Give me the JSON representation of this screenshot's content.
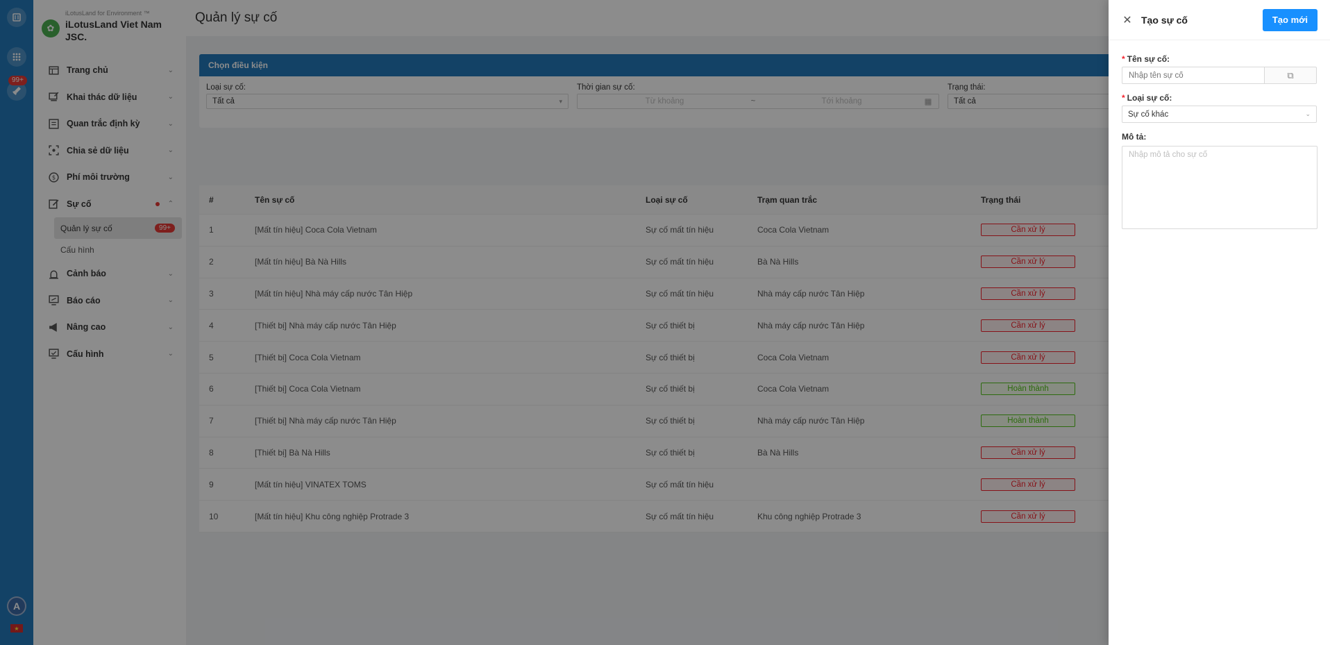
{
  "rail": {
    "badge": "99+"
  },
  "brand": {
    "sub": "iLotusLand for Environment ™",
    "name": "iLotusLand Viet Nam JSC."
  },
  "sidebar": {
    "items": [
      {
        "label": "Trang chủ",
        "icon": "home-icon"
      },
      {
        "label": "Khai thác dữ liệu",
        "icon": "data-icon"
      },
      {
        "label": "Quan trắc định kỳ",
        "icon": "monitor-icon"
      },
      {
        "label": "Chia sẻ dữ liệu",
        "icon": "share-icon"
      },
      {
        "label": "Phí môi trường",
        "icon": "fee-icon"
      },
      {
        "label": "Sự cố",
        "icon": "incident-icon"
      },
      {
        "label": "Cảnh báo",
        "icon": "alarm-icon"
      },
      {
        "label": "Báo cáo",
        "icon": "report-icon"
      },
      {
        "label": "Nâng cao",
        "icon": "megaphone-icon"
      },
      {
        "label": "Cấu hình",
        "icon": "config-icon"
      }
    ],
    "sub": {
      "manage": "Quản lý sự cố",
      "manage_badge": "99+",
      "config": "Cấu hình"
    }
  },
  "page": {
    "title": "Quản lý sự cố"
  },
  "filter": {
    "header": "Chọn điều kiện",
    "type_label": "Loại sự cố:",
    "type_value": "Tất cả",
    "time_label": "Thời gian sự cố:",
    "time_from": "Từ khoảng",
    "time_sep": "~",
    "time_to": "Tới khoảng",
    "status_label": "Trạng thái:",
    "status_value": "Tất cả"
  },
  "table": {
    "headers": {
      "num": "#",
      "name": "Tên sự cố",
      "type": "Loại sự cố",
      "station": "Trạm quan trắc",
      "status": "Trạng thái"
    },
    "rows": [
      {
        "num": "1",
        "name": "[Mất tín hiệu] Coca Cola Vietnam",
        "type": "Sự cố mất tín hiệu",
        "station": "Coca Cola Vietnam",
        "status": "Cần xử lý"
      },
      {
        "num": "2",
        "name": "[Mất tín hiệu] Bà Nà Hills",
        "type": "Sự cố mất tín hiệu",
        "station": "Bà Nà Hills",
        "status": "Cần xử lý"
      },
      {
        "num": "3",
        "name": "[Mất tín hiệu] Nhà máy cấp nước Tân Hiệp",
        "type": "Sự cố mất tín hiệu",
        "station": "Nhà máy cấp nước Tân Hiệp",
        "status": "Cần xử lý"
      },
      {
        "num": "4",
        "name": "[Thiết bị] Nhà máy cấp nước Tân Hiệp",
        "type": "Sự cố thiết bị",
        "station": "Nhà máy cấp nước Tân Hiệp",
        "status": "Cần xử lý"
      },
      {
        "num": "5",
        "name": "[Thiết bị] Coca Cola Vietnam",
        "type": "Sự cố thiết bị",
        "station": "Coca Cola Vietnam",
        "status": "Cần xử lý"
      },
      {
        "num": "6",
        "name": "[Thiết bị] Coca Cola Vietnam",
        "type": "Sự cố thiết bị",
        "station": "Coca Cola Vietnam",
        "status": "Hoàn thành"
      },
      {
        "num": "7",
        "name": "[Thiết bị] Nhà máy cấp nước Tân Hiệp",
        "type": "Sự cố thiết bị",
        "station": "Nhà máy cấp nước Tân Hiệp",
        "status": "Hoàn thành"
      },
      {
        "num": "8",
        "name": "[Thiết bị] Bà Nà Hills",
        "type": "Sự cố thiết bị",
        "station": "Bà Nà Hills",
        "status": "Cần xử lý"
      },
      {
        "num": "9",
        "name": "[Mất tín hiệu] VINATEX TOMS",
        "type": "Sự cố mất tín hiệu",
        "station": "",
        "status": "Cần xử lý"
      },
      {
        "num": "10",
        "name": "[Mất tín hiệu] Khu công nghiệp Protrade 3",
        "type": "Sự cố mất tín hiệu",
        "station": "Khu công nghiệp Protrade 3",
        "status": "Cần xử lý"
      }
    ]
  },
  "drawer": {
    "title": "Tạo sự cố",
    "create_label": "Tạo mới",
    "name_label": "Tên sự cố:",
    "name_placeholder": "Nhập tên sự cố",
    "type_label": "Loại sự cố:",
    "type_value": "Sự cố khác",
    "desc_label": "Mô tả:",
    "desc_placeholder": "Nhập mô tả cho sự cố"
  },
  "user": {
    "initial": "A"
  },
  "colors": {
    "primary": "#1890ff",
    "rail": "#2379ba",
    "danger": "#f5222d",
    "success": "#52c41a"
  }
}
